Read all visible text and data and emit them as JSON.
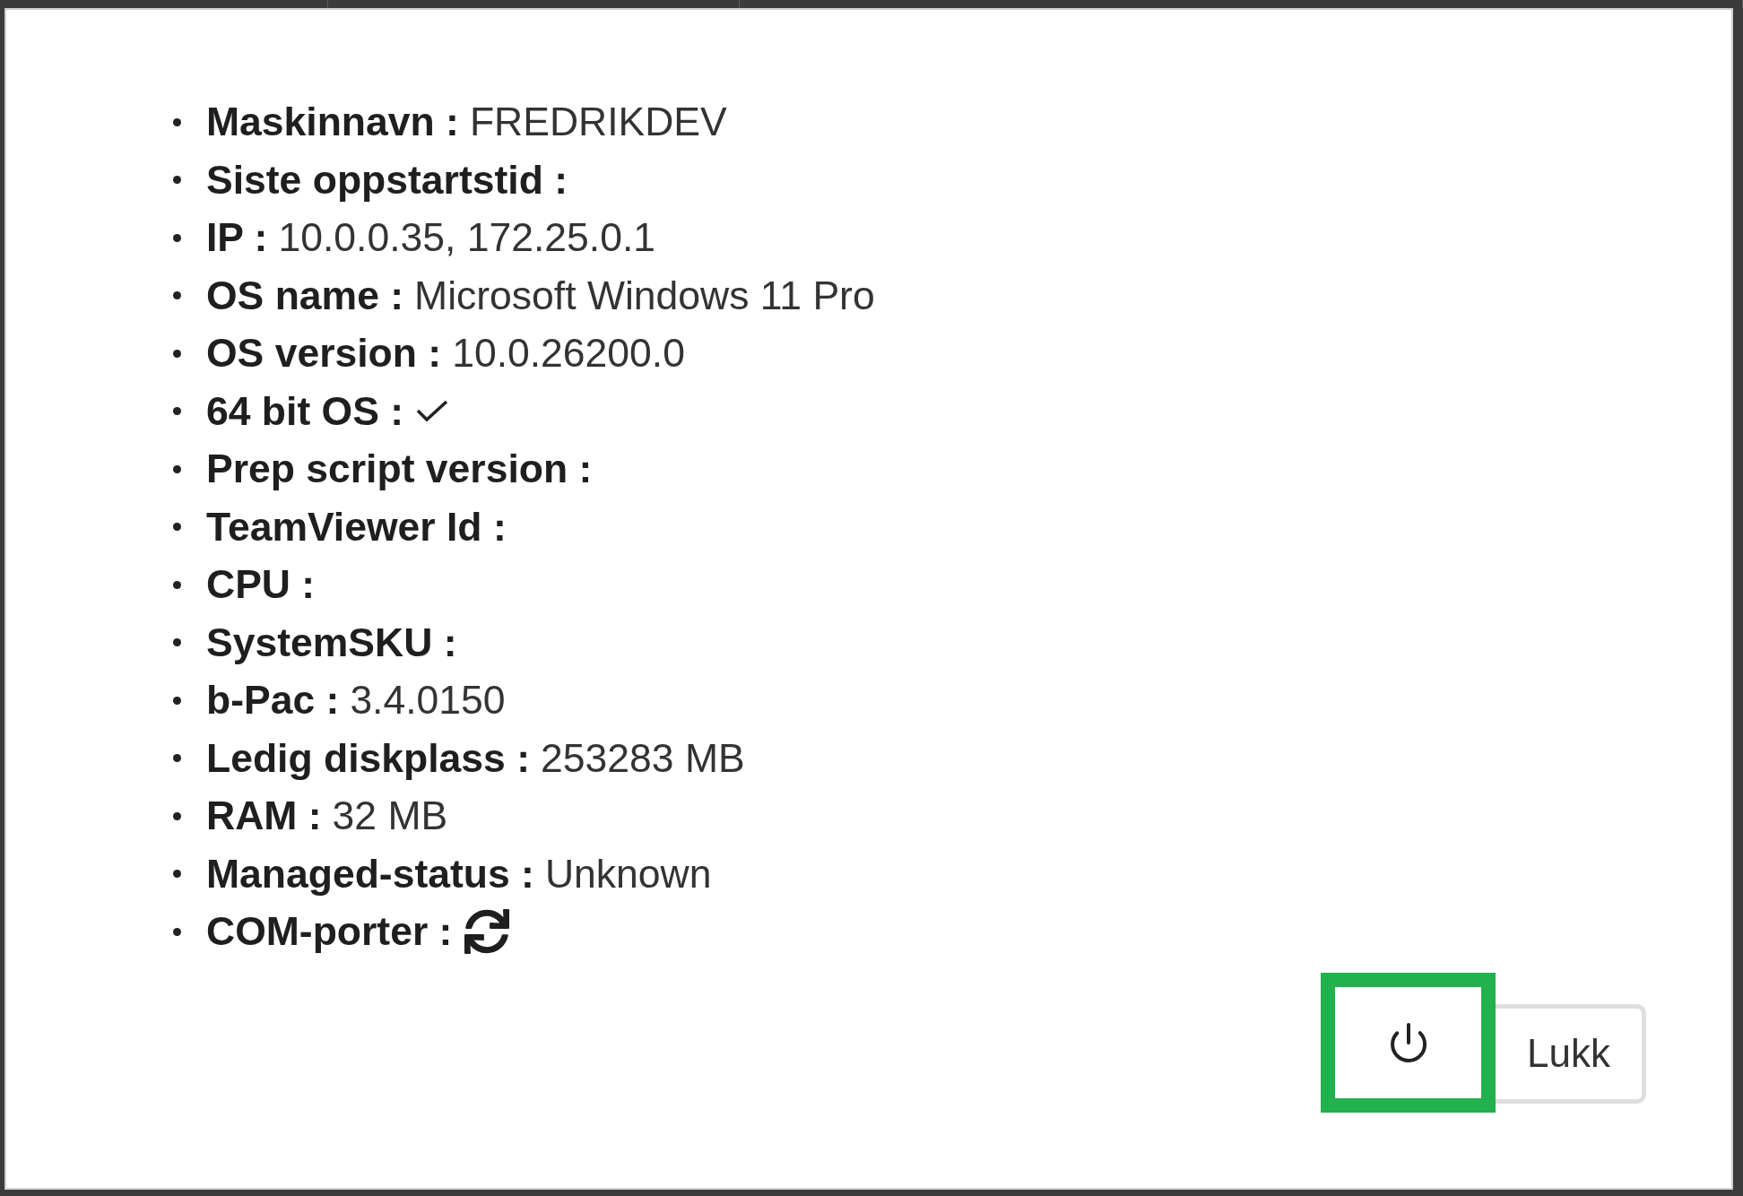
{
  "details": [
    {
      "kind": "text",
      "label": "Maskinnavn :",
      "value": "FREDRIKDEV"
    },
    {
      "kind": "text",
      "label": "Siste oppstartstid :"
    },
    {
      "kind": "text",
      "label": "IP :",
      "value": "10.0.0.35, 172.25.0.1"
    },
    {
      "kind": "text",
      "label": "OS name :",
      "value": "Microsoft Windows 11 Pro"
    },
    {
      "kind": "text",
      "label": "OS version :",
      "value": "10.0.26200.0"
    },
    {
      "kind": "check",
      "label": "64 bit OS :",
      "checked": true
    },
    {
      "kind": "text",
      "label": "Prep script version :"
    },
    {
      "kind": "text",
      "label": "TeamViewer Id :"
    },
    {
      "kind": "text",
      "label": "CPU :"
    },
    {
      "kind": "text",
      "label": "SystemSKU :"
    },
    {
      "kind": "text",
      "label": "b-Pac :",
      "value": "3.4.0150"
    },
    {
      "kind": "text",
      "label": "Ledig diskplass :",
      "value": "253283 MB"
    },
    {
      "kind": "text",
      "label": "RAM :",
      "value": "32 MB"
    },
    {
      "kind": "text",
      "label": "Managed-status :",
      "value": "Unknown"
    },
    {
      "kind": "refresh",
      "label": "COM-porter :"
    }
  ],
  "footer": {
    "power_button": {
      "highlighted": true
    },
    "close_button": {
      "label": "Lukk"
    }
  }
}
